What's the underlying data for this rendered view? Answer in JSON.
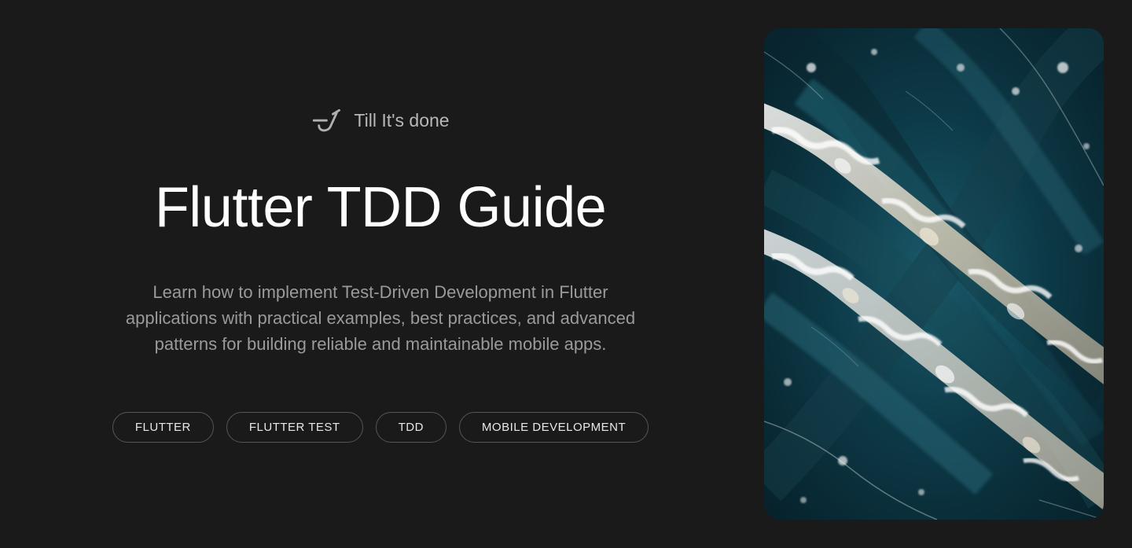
{
  "logo": {
    "text": "Till It's done"
  },
  "hero": {
    "title": "Flutter TDD Guide",
    "description": "Learn how to implement Test-Driven Development in Flutter applications with practical examples, best practices, and advanced patterns for building reliable and maintainable mobile apps."
  },
  "tags": [
    "FLUTTER",
    "FLUTTER TEST",
    "TDD",
    "MOBILE DEVELOPMENT"
  ]
}
